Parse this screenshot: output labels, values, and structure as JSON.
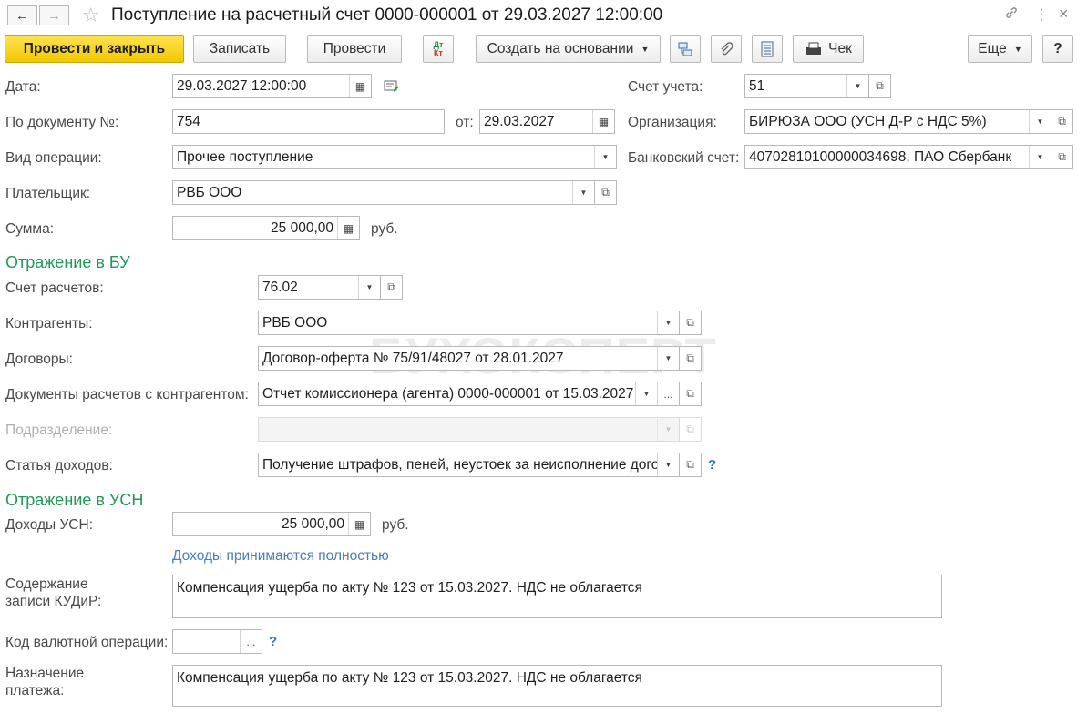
{
  "window": {
    "title": "Поступление на расчетный счет 0000-000001 от 29.03.2027 12:00:00",
    "nav_back": "←",
    "nav_forward": "→",
    "star": "☆",
    "link_icon": "🔗",
    "more_icon": "⋮",
    "close_icon": "×"
  },
  "toolbar": {
    "post_and_close": "Провести и закрыть",
    "save": "Записать",
    "post": "Провести",
    "dt": "Дт",
    "kt": "Кт",
    "create_based_on": "Создать на основании",
    "receipt": "Чек",
    "more": "Еще",
    "help": "?"
  },
  "watermark": "БУХЭКСПЕРТ",
  "header": {
    "date": {
      "label": "Дата:",
      "value": "29.03.2027 12:00:00"
    },
    "doc_number": {
      "label": "По документу №:",
      "value": "754"
    },
    "from": {
      "label": "от:",
      "value": "29.03.2027"
    },
    "operation_type": {
      "label": "Вид операции:",
      "value": "Прочее поступление"
    },
    "payer": {
      "label": "Плательщик:",
      "value": "РВБ ООО"
    },
    "amount": {
      "label": "Сумма:",
      "value": "25 000,00",
      "unit": "руб."
    },
    "account": {
      "label": "Счет учета:",
      "value": "51"
    },
    "organization": {
      "label": "Организация:",
      "value": "БИРЮЗА ООО (УСН Д-Р с НДС 5%)"
    },
    "bank_account": {
      "label": "Банковский счет:",
      "value": "40702810100000034698, ПАО Сбербанк"
    }
  },
  "bu": {
    "title": "Отражение в БУ",
    "settlement_account": {
      "label": "Счет расчетов:",
      "value": "76.02"
    },
    "counterparties": {
      "label": "Контрагенты:",
      "value": "РВБ ООО"
    },
    "contracts": {
      "label": "Договоры:",
      "value": "Договор-оферта № 75/91/48027 от 28.01.2027"
    },
    "settlement_docs": {
      "label": "Документы расчетов с контрагентом:",
      "value": "Отчет комиссионера (агента) 0000-000001 от 15.03.2027"
    },
    "division": {
      "label": "Подразделение:",
      "value": ""
    },
    "income_item": {
      "label": "Статья доходов:",
      "value": "Получение штрафов, пеней, неустоек за неисполнение договоров"
    },
    "help": "?"
  },
  "usn": {
    "title": "Отражение в УСН",
    "income": {
      "label": "Доходы УСН:",
      "value": "25 000,00",
      "unit": "руб."
    },
    "income_link": "Доходы принимаются полностью",
    "kudir_label_1": "Содержание",
    "kudir_label_2": "записи КУДиР:",
    "kudir_value": "Компенсация ущерба по акту № 123 от 15.03.2027. НДС не облагается",
    "currency_op": {
      "label": "Код валютной операции:",
      "value": ""
    },
    "help": "?",
    "purpose_label_1": "Назначение",
    "purpose_label_2": "платежа:",
    "purpose_value": "Компенсация ущерба по акту № 123 от 15.03.2027. НДС не облагается"
  },
  "icons": {
    "calendar": "▦",
    "calc": "▦",
    "dropdown": "▼",
    "open": "⧉",
    "ellipsis": "...",
    "chevron_down": "▼"
  }
}
